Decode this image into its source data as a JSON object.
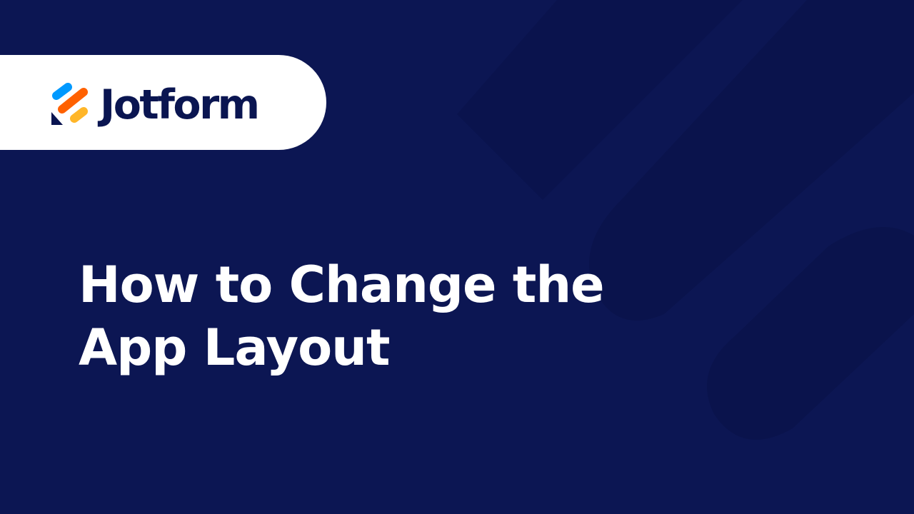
{
  "colors": {
    "background": "#0c1653",
    "shape_tint": "#0a1248",
    "logo_pill": "#ffffff",
    "logo_text": "#0a1551",
    "title_text": "#ffffff",
    "mark_blue": "#0099ff",
    "mark_orange": "#ff6100",
    "mark_yellow": "#ffb629",
    "mark_navy": "#0a1551"
  },
  "logo": {
    "icon": "jotform-logo-icon",
    "text": "Jotform"
  },
  "title": {
    "line1": "How to Change the",
    "line2": "App Layout"
  }
}
